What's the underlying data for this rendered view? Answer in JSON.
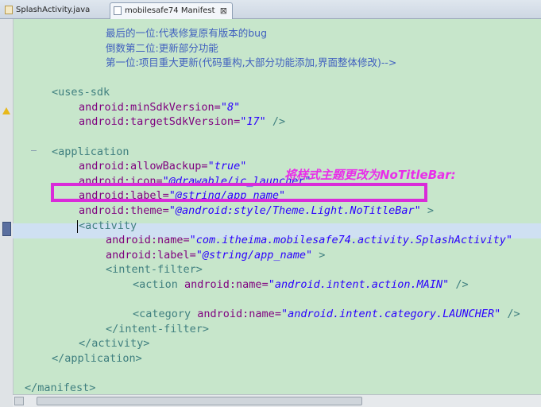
{
  "tabs": [
    {
      "label": "SplashActivity.java",
      "icon": "java-file-icon"
    },
    {
      "label": "mobilesafe74 Manifest",
      "icon": "manifest-file-icon",
      "close": "⊠"
    }
  ],
  "code": {
    "comment1": "最后的一位:代表修复原有版本的bug",
    "comment2": "倒数第二位:更新部分功能",
    "comment3": "第一位:项目重大更新(代码重构,大部分功能添加,界面整体修改)-->",
    "uses_sdk_open": "<uses-sdk",
    "min_sdk_attr": "android:minSdkVersion=",
    "min_sdk_val": "\"8\"",
    "target_sdk_attr": "android:targetSdkVersion=",
    "target_sdk_val": "\"17\"",
    "self_close": " />",
    "application_open": "<application",
    "allow_backup_attr": "android:allowBackup=",
    "allow_backup_val": "\"true\"",
    "icon_attr": "android:icon=",
    "icon_val": "\"@drawable/ic_launcher\"",
    "label_attr": "android:label=",
    "label_val": "\"@string/app_name\"",
    "theme_attr": "android:theme=",
    "theme_val": "\"@android:style/Theme.Light.NoTitleBar\"",
    "gt": " >",
    "activity_open": "<activity",
    "activity_name_attr": "android:name=",
    "activity_name_val": "\"com.itheima.mobilesafe74.activity.SplashActivity\"",
    "activity_label_attr": "android:label=",
    "activity_label_val": "\"@string/app_name\"",
    "intent_filter_open": "<intent-filter>",
    "action_open": "<action ",
    "action_attr": "android:name=",
    "action_val": "\"android.intent.action.MAIN\"",
    "category_open": "<category ",
    "category_attr": "android:name=",
    "category_val": "\"android.intent.category.LAUNCHER\"",
    "intent_filter_close": "</intent-filter>",
    "activity_close": "</activity>",
    "application_close": "</application>",
    "manifest_close": "</manifest>"
  },
  "annotation": "将样式主题更改为NoTitleBar:",
  "colors": {
    "editor_bg": "#c7e6cb",
    "highlight_box": "#d92bd9",
    "annotation_text": "#e92ee9",
    "tag": "#3f7f7f",
    "attribute": "#7f007f",
    "value": "#2a00ff",
    "comment": "#3f5fbf"
  }
}
